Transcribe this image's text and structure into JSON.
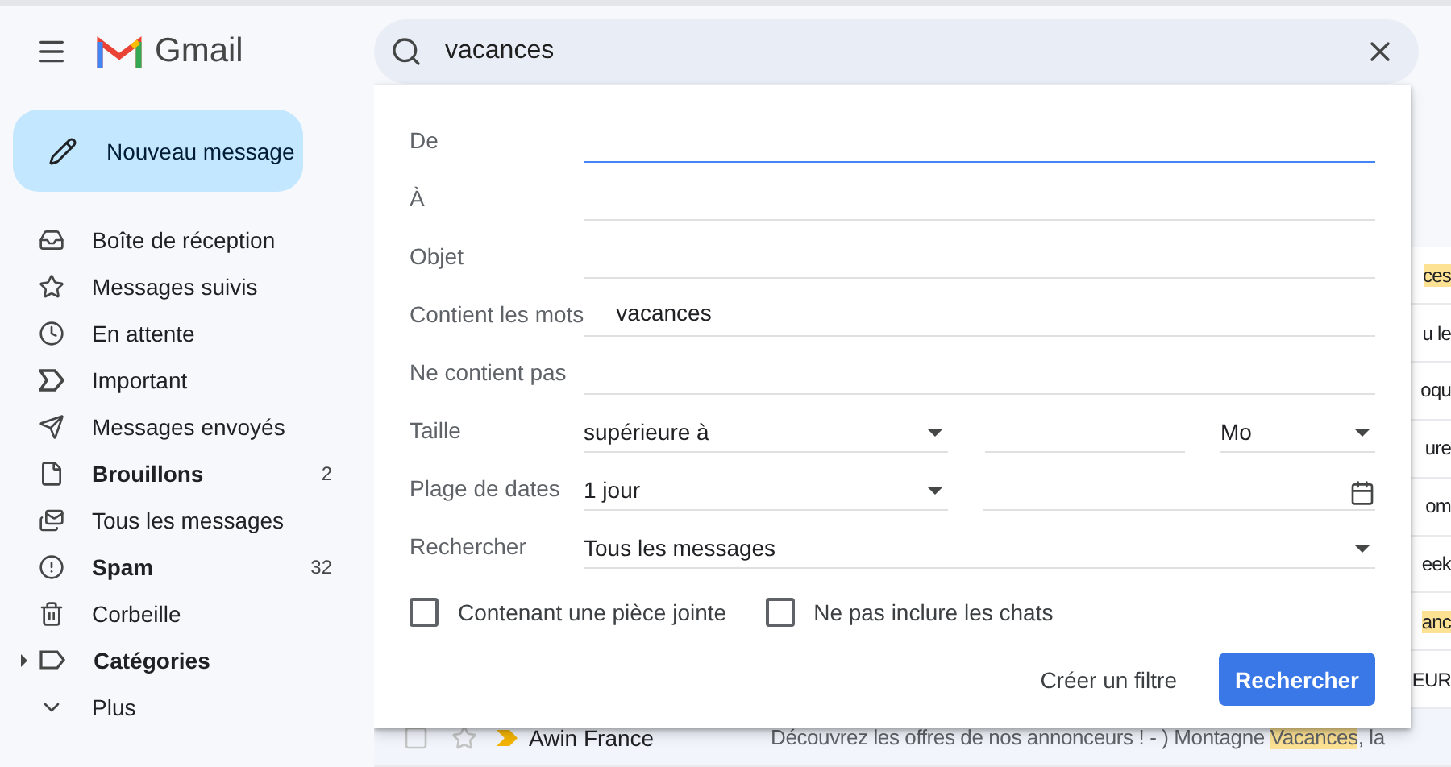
{
  "header": {
    "logo_text": "Gmail"
  },
  "compose": {
    "label": "Nouveau message"
  },
  "sidebar": {
    "items": [
      {
        "kind": "inbox",
        "label": "Boîte de réception",
        "bold": false
      },
      {
        "kind": "star",
        "label": "Messages suivis",
        "bold": false
      },
      {
        "kind": "clock",
        "label": "En attente",
        "bold": false
      },
      {
        "kind": "important",
        "label": "Important",
        "bold": false
      },
      {
        "kind": "send",
        "label": "Messages envoyés",
        "bold": false
      },
      {
        "kind": "file",
        "label": "Brouillons",
        "bold": true,
        "count": "2"
      },
      {
        "kind": "mails",
        "label": "Tous les messages",
        "bold": false
      },
      {
        "kind": "spam",
        "label": "Spam",
        "bold": true,
        "count": "32"
      },
      {
        "kind": "trash",
        "label": "Corbeille",
        "bold": false
      },
      {
        "kind": "label",
        "label": "Catégories",
        "bold": true,
        "expanded": false
      },
      {
        "kind": "more",
        "label": "Plus",
        "bold": false
      }
    ]
  },
  "search": {
    "value": "vacances"
  },
  "advanced_search": {
    "fields": [
      {
        "kind": "text",
        "label": "De",
        "focused": true
      },
      {
        "kind": "text",
        "label": "À",
        "focused": false
      },
      {
        "kind": "text",
        "label": "Objet",
        "focused": false
      },
      {
        "kind": "text",
        "label": "Contient les mots",
        "value": "vacances",
        "focused": false
      },
      {
        "kind": "text",
        "label": "Ne contient pas",
        "focused": false
      },
      {
        "kind": "size",
        "label": "Taille",
        "operator": "supérieure à",
        "unit": "Mo"
      },
      {
        "kind": "date",
        "label": "Plage de dates",
        "range": "1 jour"
      },
      {
        "kind": "select",
        "label": "Rechercher",
        "value": "Tous les messages"
      }
    ],
    "checkboxes": [
      {
        "label": "Contenant une pièce jointe",
        "checked": false
      },
      {
        "label": "Ne pas inclure les chats",
        "checked": false
      }
    ],
    "create_filter": "Créer un filtre",
    "submit": "Rechercher"
  },
  "emails": [
    {
      "parts": [
        {
          "text": "ces",
          "highlighted": true
        }
      ]
    },
    {
      "parts": [
        {
          "text": "u le",
          "highlighted": false
        }
      ]
    },
    {
      "parts": [
        {
          "text": "oqu",
          "highlighted": false
        }
      ]
    },
    {
      "parts": [
        {
          "text": "ure",
          "highlighted": false
        }
      ]
    },
    {
      "parts": [
        {
          "text": "om",
          "highlighted": false
        }
      ]
    },
    {
      "parts": [
        {
          "text": "eek",
          "highlighted": false
        }
      ]
    },
    {
      "parts": [
        {
          "text": "anc",
          "highlighted": true
        }
      ]
    },
    {
      "parts": [
        {
          "text": "EUR",
          "highlighted": false
        }
      ]
    },
    {
      "sender": "Awin France",
      "important": true,
      "starred": false,
      "parts": [
        {
          "text": "Découvrez les offres de nos annonceurs ! - ) Montagne ",
          "highlighted": false
        },
        {
          "text": "Vacances",
          "highlighted": true
        },
        {
          "text": ", la",
          "highlighted": false
        }
      ]
    }
  ]
}
